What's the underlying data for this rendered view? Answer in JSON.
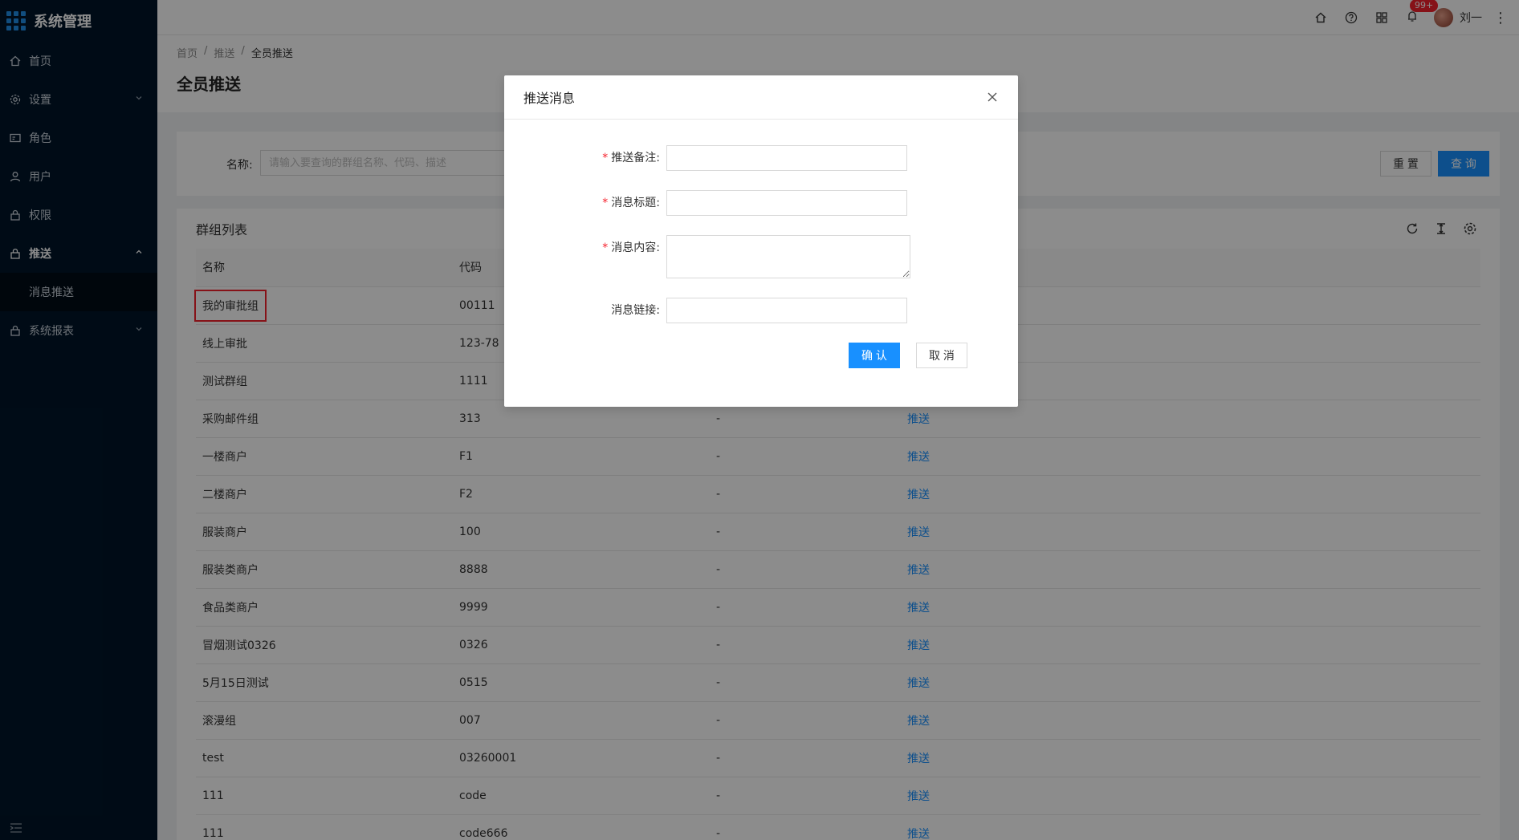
{
  "app": {
    "title": "系统管理"
  },
  "sidebar": {
    "items": [
      {
        "label": "首页",
        "icon": "home-icon",
        "expanded": false
      },
      {
        "label": "设置",
        "icon": "gear-icon",
        "expanded": false
      },
      {
        "label": "角色",
        "icon": "id-card-icon",
        "expanded": false
      },
      {
        "label": "用户",
        "icon": "user-icon",
        "expanded": false
      },
      {
        "label": "权限",
        "icon": "lock-icon",
        "expanded": false
      },
      {
        "label": "推送",
        "icon": "lock-icon",
        "expanded": true
      },
      {
        "label": "系统报表",
        "icon": "lock-icon",
        "expanded": false
      }
    ],
    "submenu": {
      "label": "消息推送"
    }
  },
  "header": {
    "badge_count": "99+",
    "user_name": "刘一"
  },
  "breadcrumb": [
    "首页",
    "推送",
    "全员推送"
  ],
  "page": {
    "title": "全员推送"
  },
  "search": {
    "label": "名称:",
    "placeholder": "请输入要查询的群组名称、代码、描述",
    "reset_label": "重 置",
    "query_label": "查 询"
  },
  "table": {
    "title": "群组列表",
    "columns": [
      "名称",
      "代码"
    ],
    "rows": [
      {
        "name": "我的审批组",
        "code": "00111",
        "desc": "",
        "action": ""
      },
      {
        "name": "线上审批",
        "code": "123-78",
        "desc": "",
        "action": ""
      },
      {
        "name": "测试群组",
        "code": "1111",
        "desc": "",
        "action": ""
      },
      {
        "name": "采购邮件组",
        "code": "313",
        "desc": "-",
        "action": "推送"
      },
      {
        "name": "一楼商户",
        "code": "F1",
        "desc": "-",
        "action": "推送"
      },
      {
        "name": "二楼商户",
        "code": "F2",
        "desc": "-",
        "action": "推送"
      },
      {
        "name": "服装商户",
        "code": "100",
        "desc": "-",
        "action": "推送"
      },
      {
        "name": "服装类商户",
        "code": "8888",
        "desc": "-",
        "action": "推送"
      },
      {
        "name": "食品类商户",
        "code": "9999",
        "desc": "-",
        "action": "推送"
      },
      {
        "name": "冒烟测试0326",
        "code": "0326",
        "desc": "-",
        "action": "推送"
      },
      {
        "name": "5月15日测试",
        "code": "0515",
        "desc": "-",
        "action": "推送"
      },
      {
        "name": "滚漫组",
        "code": "007",
        "desc": "-",
        "action": "推送"
      },
      {
        "name": "test",
        "code": "03260001",
        "desc": "-",
        "action": "推送"
      },
      {
        "name": "111",
        "code": "code",
        "desc": "-",
        "action": "推送"
      },
      {
        "name": "111",
        "code": "code666",
        "desc": "-",
        "action": "推送"
      }
    ]
  },
  "modal": {
    "title": "推送消息",
    "fields": [
      {
        "label": "推送备注:",
        "required": true,
        "value": ""
      },
      {
        "label": "消息标题:",
        "required": true,
        "value": ""
      },
      {
        "label": "消息内容:",
        "required": true,
        "value": ""
      },
      {
        "label": "消息链接:",
        "required": false,
        "value": ""
      }
    ],
    "confirm_label": "确 认",
    "cancel_label": "取 消"
  },
  "colors": {
    "sidebar_bg": "#001529",
    "primary": "#1890ff",
    "highlight": "#f5222d"
  }
}
